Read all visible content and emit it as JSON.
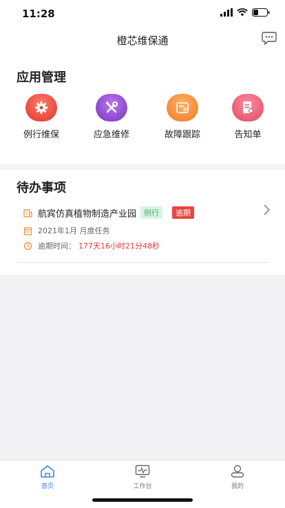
{
  "status_bar": {
    "time": "11:28"
  },
  "nav": {
    "title": "橙芯维保通",
    "chat_icon": "chat-bubble-icon"
  },
  "apps": {
    "title": "应用管理",
    "items": [
      {
        "label": "例行维保",
        "icon": "gear-icon",
        "color": "#e8433a"
      },
      {
        "label": "应急维修",
        "icon": "wrench-screwdriver-icon",
        "color": "#8e45c9"
      },
      {
        "label": "故障跟踪",
        "icon": "ticket-icon",
        "color": "#f08a2c"
      },
      {
        "label": "告知单",
        "icon": "document-icon",
        "color": "#e7516a"
      }
    ]
  },
  "todo": {
    "title": "待办事项",
    "items": [
      {
        "name": "航宾仿真植物制造产业园",
        "tag_routine": "例行",
        "tag_overdue": "逾期",
        "period": "2021年1月 月度任务",
        "overdue_label": "逾期时间：",
        "overdue_value": "177天16小时21分48秒"
      }
    ]
  },
  "tabs": [
    {
      "label": "首页",
      "icon": "home-icon",
      "active": true
    },
    {
      "label": "工作台",
      "icon": "monitor-icon",
      "active": false
    },
    {
      "label": "我的",
      "icon": "user-icon",
      "active": false
    }
  ],
  "colors": {
    "accent": "#3f80e4",
    "orange": "#f08a2c",
    "danger": "#e5383c"
  }
}
